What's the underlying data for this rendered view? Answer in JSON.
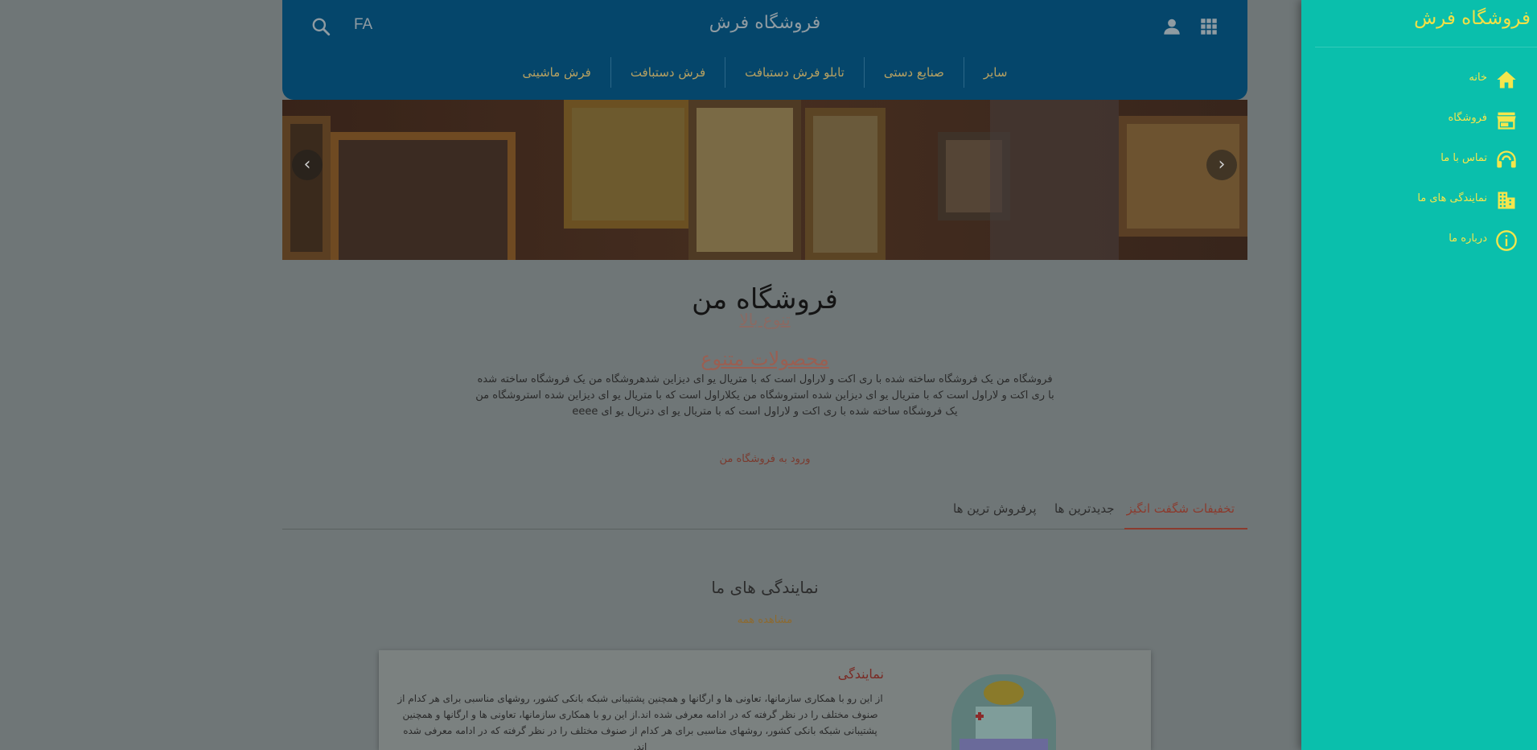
{
  "header": {
    "brand": "فروشگاه فرش",
    "lang": "FA",
    "nav": [
      "فرش ماشینی",
      "فرش دستبافت",
      "تابلو فرش دستبافت",
      "صنایع دستی",
      "سایر"
    ]
  },
  "hero": {
    "prev_arrow": "‹",
    "next_arrow": "›"
  },
  "intro": {
    "title": "فروشگاه من",
    "subtitle": "تنوع بالا",
    "products_link": "محصولات متنوع",
    "description": "فروشگاه من یک فروشگاه ساخته شده با ری اکت و لاراول است که با متریال یو ای دیزاین شدهروشگاه من یک فروشگاه ساخته شده با ری اکت و لاراول است که با متریال یو ای دیزاین شده استروشگاه من یکلاراول است که با متریال یو ای دیزاین شده استروشگاه من یک فروشگاه ساخته شده با ری اکت و لاراول است که با متریال یو ای دتریال یو ای eeee",
    "enter_link": "ورود به فروشگاه من"
  },
  "tabs": {
    "items": [
      "تخفیفات شگفت انگیز",
      "جدیدترین ها",
      "پرفروش ترین ها"
    ],
    "active": "تخفیفات شگفت انگیز"
  },
  "agencies": {
    "title": "نمایندگی های ما",
    "see_all": "مشاهده همه",
    "card": {
      "name": "نمایندگی",
      "text": "از این رو با همکاری سازمانها، تعاونی ها و ارگانها و همچنین پشتیبانی شبکه بانکی کشور، روشهای مناسبی برای هر کدام از صنوف مختلف را در نظر گرفته که در ادامه معرفی شده اند.از این رو با همکاری سازمانها، تعاونی ها و ارگانها و همچنین پشتیبانی شبکه بانکی کشور، روشهای مناسبی برای هر کدام از صنوف مختلف را در نظر گرفته که در ادامه معرفی شده اند."
    }
  },
  "drawer": {
    "title": "فروشگاه فرش",
    "items": [
      {
        "label": "خانه",
        "icon": "home-icon"
      },
      {
        "label": "فروشگاه",
        "icon": "store-icon"
      },
      {
        "label": "تماس با ما",
        "icon": "headset-icon"
      },
      {
        "label": "نمایندگی های ما",
        "icon": "building-icon"
      },
      {
        "label": "درباره ما",
        "icon": "info-icon"
      }
    ]
  },
  "colors": {
    "header_bg": "#05466b",
    "drawer_bg": "#0abfac",
    "drawer_text": "#f4e64c",
    "accent": "#8b3b2e"
  }
}
